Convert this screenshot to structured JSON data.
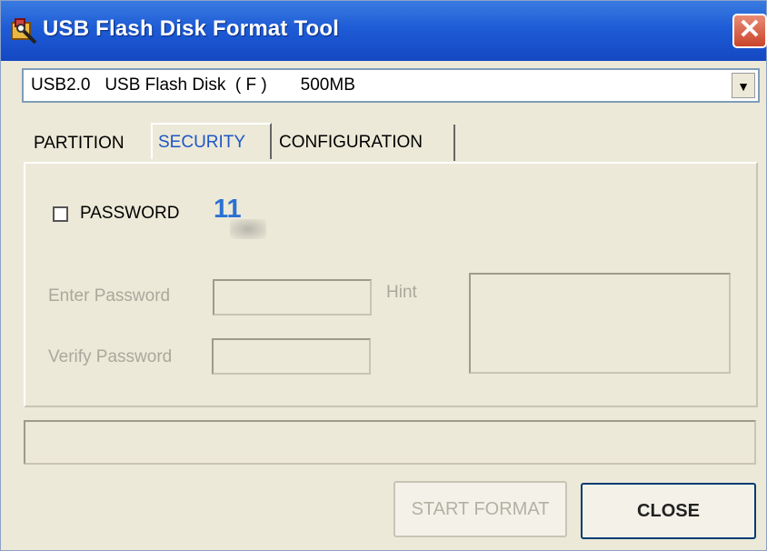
{
  "window": {
    "title": "USB Flash Disk Format Tool",
    "close_glyph": "✕"
  },
  "device_select": {
    "value": "USB2.0   USB Flash Disk  ( F )       500MB",
    "arrow_glyph": "▼"
  },
  "tabs": [
    {
      "label": "PARTITION",
      "active": false
    },
    {
      "label": "SECURITY",
      "active": true
    },
    {
      "label": "CONFIGURATION",
      "active": false
    }
  ],
  "security": {
    "password_checkbox": {
      "label": "PASSWORD",
      "checked": false
    },
    "annotation": "11",
    "enter_password_label": "Enter Password",
    "enter_password_value": "",
    "verify_password_label": "Verify Password",
    "verify_password_value": "",
    "hint_label": "Hint",
    "hint_value": ""
  },
  "status": {
    "text": ""
  },
  "buttons": {
    "start_format": {
      "label": "START FORMAT",
      "enabled": false
    },
    "close": {
      "label": "CLOSE",
      "enabled": true
    }
  },
  "colors": {
    "titlebar": "#1d5cd6",
    "window_bg": "#ece9d8",
    "active_tab_text": "#1f56c8",
    "annotation": "#2b71d2",
    "disabled_text": "#aaa89c"
  },
  "icons": {
    "app": "usb-format-app-icon",
    "close": "close-icon",
    "dropdown": "chevron-down-icon"
  }
}
